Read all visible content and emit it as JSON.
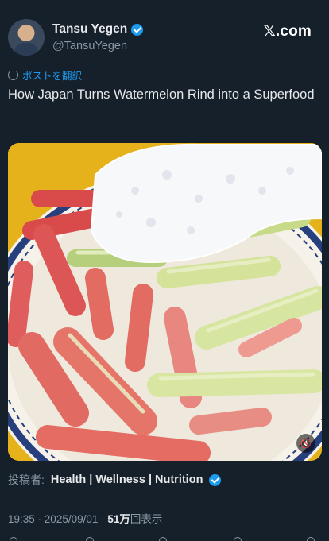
{
  "author": {
    "name": "Tansu Yegen",
    "handle": "@TansuYegen"
  },
  "brand": {
    "logo_text": "𝕏.com"
  },
  "translate": {
    "label": "ポストを翻訳"
  },
  "tweet": {
    "text": "How Japan Turns Watermelon Rind into a Superfood"
  },
  "media": {
    "kind": "video",
    "mute_icon": "speaker-mute-icon"
  },
  "poster": {
    "label": "投稿者:",
    "name": "Health | Wellness | Nutrition"
  },
  "meta": {
    "time": "19:35",
    "separator1": " · ",
    "date": "2025/09/01",
    "separator2": " · ",
    "views_count": "51万",
    "views_label": "回表示"
  },
  "colors": {
    "background": "#15202b",
    "accent": "#1d9bf0",
    "secondary_text": "#8b98a5"
  }
}
